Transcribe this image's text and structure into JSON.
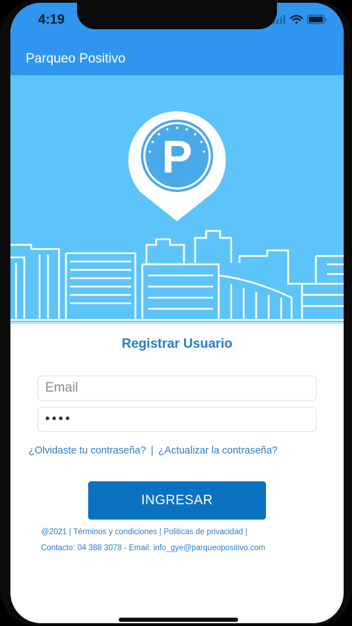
{
  "status_bar": {
    "time": "4:19"
  },
  "app_bar": {
    "title": "Parqueo Positivo"
  },
  "hero": {
    "logo_letter": "P"
  },
  "form": {
    "title": "Registrar Usuario",
    "email_placeholder": "Email",
    "email_value": "",
    "password_value": "••••",
    "forgot_password": "¿Olvidaste tu contraseña?",
    "separator": "|",
    "update_password": "¿Actualizar la contraseña?",
    "submit_label": "INGRESAR"
  },
  "footer": {
    "copyright": "@2021",
    "separator": "|",
    "terms": "Términos y condiciones",
    "privacy": "Politicas de privacidad",
    "contact_label": "Contacto:",
    "phone": "04 388 3078",
    "email_label": "- Email:",
    "email": "info_gye@parqueopositivo.com"
  },
  "colors": {
    "app_bar": "#2f95ef",
    "hero_background": "#5cc4f9",
    "accent_text": "#2d7cc7",
    "button": "#0b72c2"
  },
  "icons": [
    "signal-icon",
    "wifi-icon",
    "battery-icon",
    "parking-pin-icon",
    "city-skyline"
  ]
}
